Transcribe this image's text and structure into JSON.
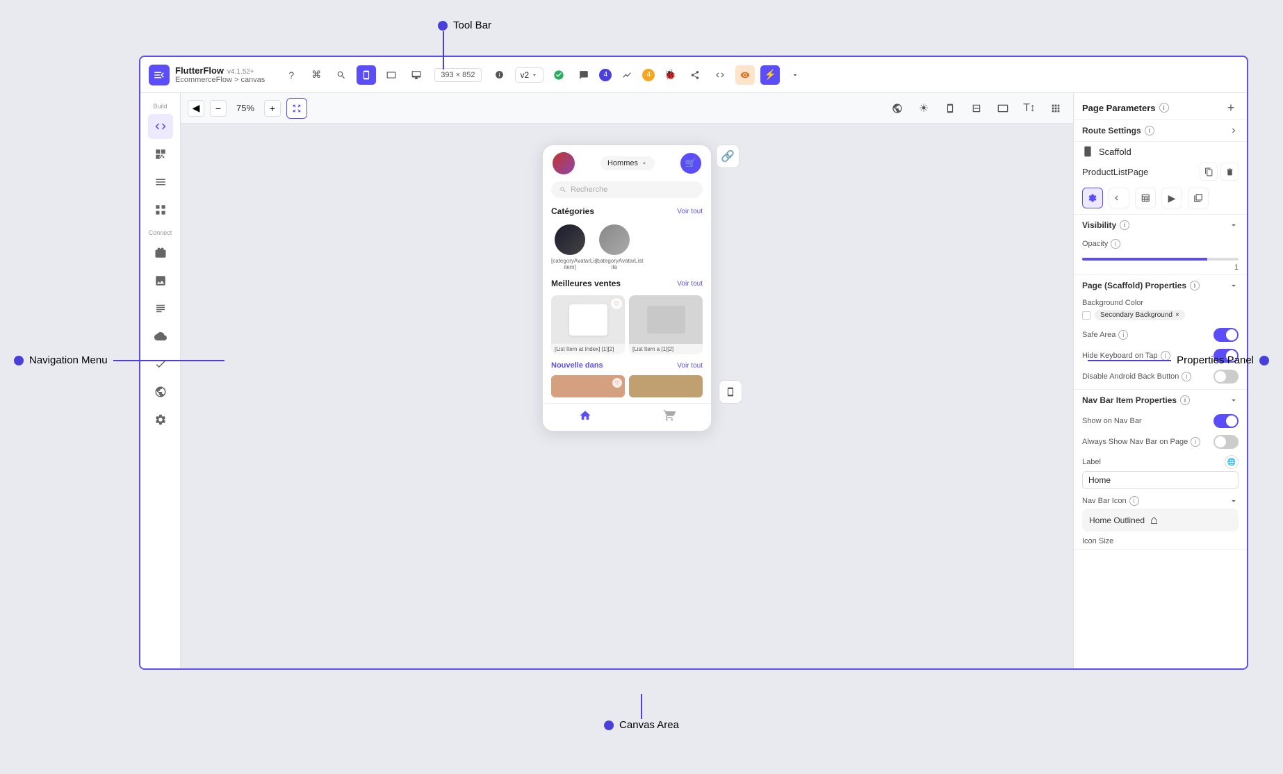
{
  "app": {
    "title": "FlutterFlow",
    "version": "v4.1.52+",
    "breadcrumb": "EcommerceFlow > canvas"
  },
  "toolbar": {
    "zoom": "75%",
    "size_display": "393 × 852",
    "version_label": "v2",
    "badge_count": "4",
    "orange_badge": "4",
    "icon_help": "?",
    "icon_shortcut": "⌘",
    "icon_search": "🔍"
  },
  "left_nav": {
    "build_label": "Build",
    "connect_label": "Connect",
    "icons": [
      {
        "name": "build-icon",
        "symbol": "⚡",
        "active": false
      },
      {
        "name": "widgets-icon",
        "symbol": "⊞",
        "active": false
      },
      {
        "name": "layers-icon",
        "symbol": "≡",
        "active": false
      },
      {
        "name": "components-icon",
        "symbol": "⊡",
        "active": false
      },
      {
        "name": "data-icon",
        "symbol": "⊛",
        "active": false
      },
      {
        "name": "media-icon",
        "symbol": "🖼",
        "active": false
      },
      {
        "name": "text-icon",
        "symbol": "≣",
        "active": false
      },
      {
        "name": "cloud-icon",
        "symbol": "☁",
        "active": false
      },
      {
        "name": "test-icon",
        "symbol": "✓",
        "active": false
      },
      {
        "name": "api-icon",
        "symbol": "⟳",
        "active": false
      },
      {
        "name": "settings-icon",
        "symbol": "⚙",
        "active": false
      }
    ]
  },
  "phone": {
    "dropdown_text": "Hommes",
    "search_placeholder": "Recherche",
    "categories_title": "Catégories",
    "categories_voir_tout": "Voir tout",
    "bestsellers_title": "Meilleures ventes",
    "bestsellers_voir_tout": "Voir tout",
    "new_title": "Nouvelle dans",
    "new_voir_tout": "Voir tout",
    "cat_label_1": "[categoryAvatarList item]",
    "cat_label_2": "[categoryAvatarList ite",
    "product_label_1": "[List Item at Index]\n[1][2]",
    "product_label_2": "[List Item a\n[1][2]"
  },
  "properties": {
    "page_parameters_label": "Page Parameters",
    "route_settings_label": "Route Settings",
    "scaffold_label": "Scaffold",
    "page_name": "ProductListPage",
    "visibility_label": "Visibility",
    "opacity_label": "Opacity",
    "opacity_value": "1",
    "page_scaffold_label": "Page (Scaffold) Properties",
    "background_color_label": "Background Color",
    "secondary_background_label": "Secondary Background",
    "safe_area_label": "Safe Area",
    "hide_keyboard_label": "Hide Keyboard on Tap",
    "disable_android_label": "Disable Android Back Button",
    "nav_bar_item_label": "Nav Bar Item Properties",
    "show_on_nav_bar_label": "Show on Nav Bar",
    "always_show_nav_bar_label": "Always Show Nav Bar on Page",
    "label_label": "Label",
    "label_value": "Home",
    "nav_bar_icon_label": "Nav Bar Icon",
    "icon_size_label": "Icon Size",
    "home_outlined_label": "Home Outlined",
    "safe_area_on": true,
    "hide_keyboard_on": true,
    "disable_android_on": false,
    "show_on_nav_bar_on": true,
    "always_show_nav_bar_on": false
  },
  "annotations": {
    "tool_bar": "Tool Bar",
    "navigation_menu": "Navigation Menu",
    "properties_panel": "Properties Panel",
    "canvas_area": "Canvas Area"
  }
}
